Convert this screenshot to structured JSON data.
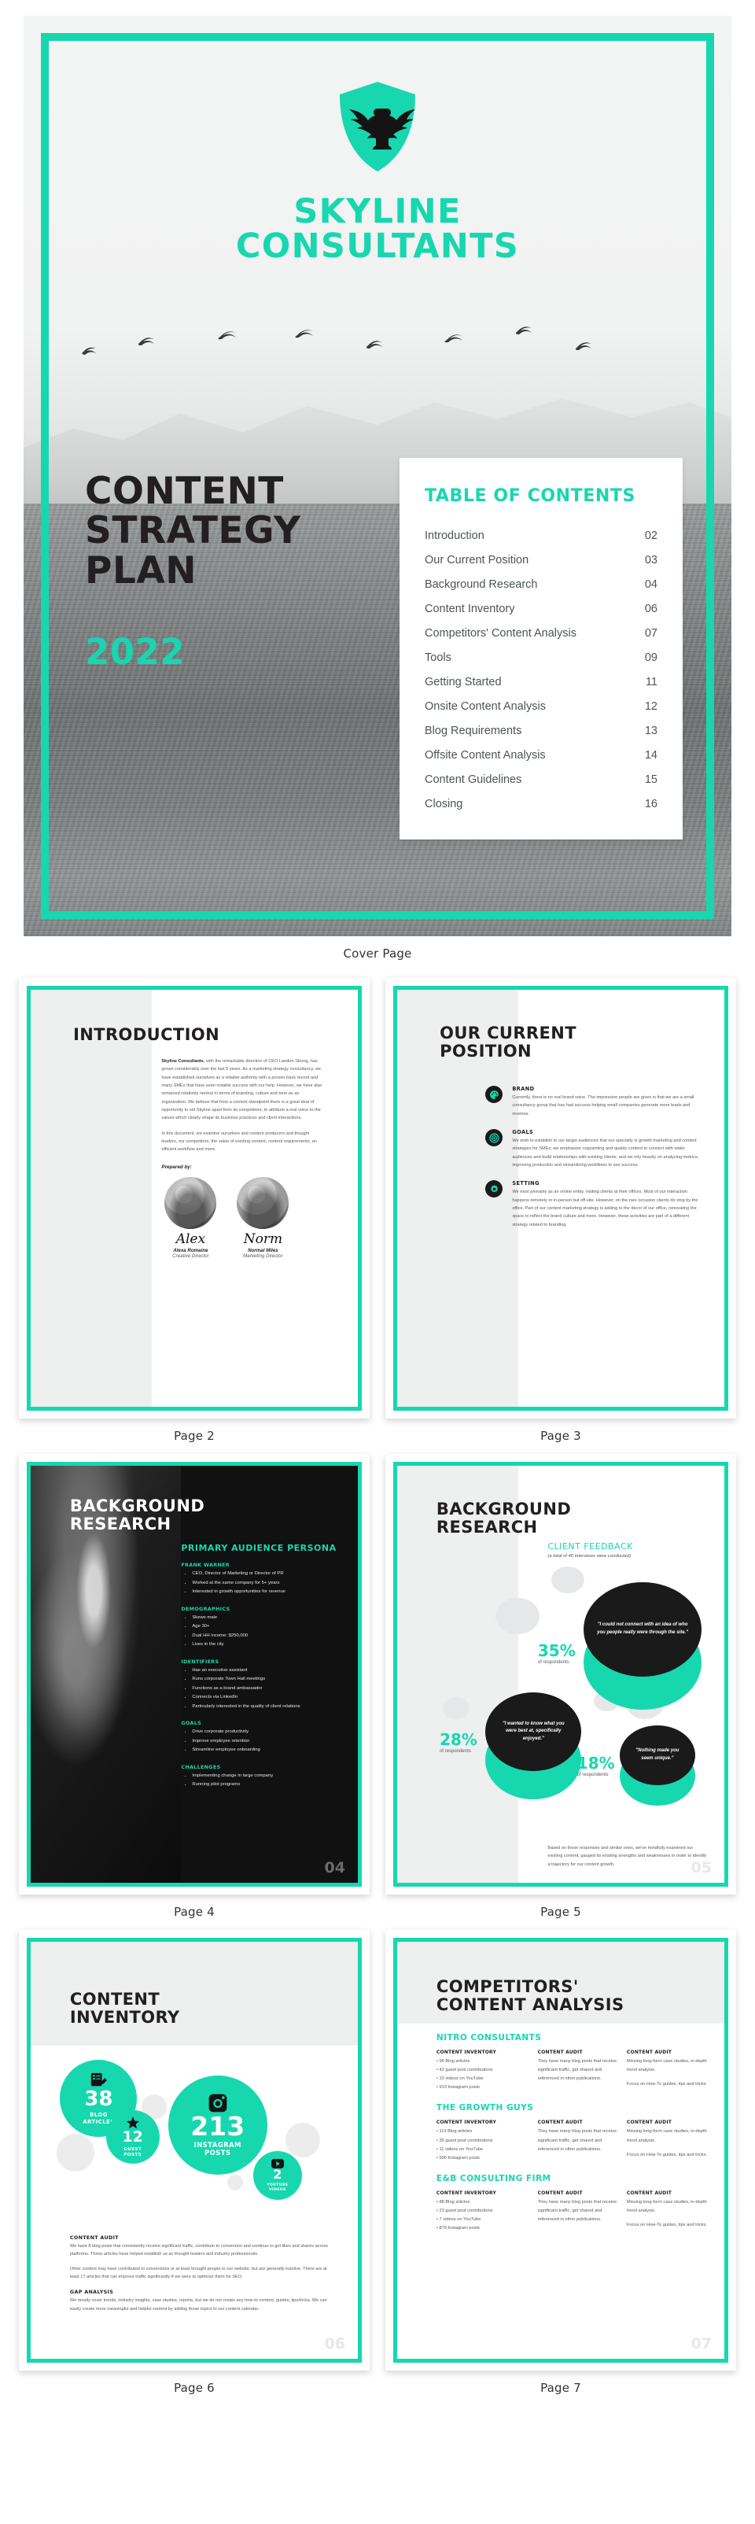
{
  "cover": {
    "brand_line1": "SKYLINE",
    "brand_line2": "CONSULTANTS",
    "logo_icon": "eagle-shield-logo",
    "heading_line1": "CONTENT",
    "heading_line2": "STRATEGY",
    "heading_line3": "PLAN",
    "year": "2022",
    "caption": "Cover Page",
    "accent": "#17d7af",
    "toc": {
      "title": "TABLE OF CONTENTS",
      "rows": [
        {
          "label": "Introduction",
          "page": "02"
        },
        {
          "label": "Our Current Position",
          "page": "03"
        },
        {
          "label": "Background Research",
          "page": "04"
        },
        {
          "label": "Content Inventory",
          "page": "06"
        },
        {
          "label": "Competitors' Content Analysis",
          "page": "07"
        },
        {
          "label": "Tools",
          "page": "09"
        },
        {
          "label": "Getting Started",
          "page": "11"
        },
        {
          "label": "Onsite Content Analysis",
          "page": "12"
        },
        {
          "label": "Blog Requirements",
          "page": "13"
        },
        {
          "label": "Offsite Content Analysis",
          "page": "14"
        },
        {
          "label": "Content Guidelines",
          "page": "15"
        },
        {
          "label": "Closing",
          "page": "16"
        }
      ]
    }
  },
  "page2": {
    "caption": "Page 2",
    "title": "INTRODUCTION",
    "para1_lead": "Skyline Consultants",
    "para1_rest": ", with the remarkable direction of CEO Landon Strong, has grown considerably over the last 5 years. As a marketing strategy consultancy, we have established ourselves as a reliable authority with a proven track record and many SMEs that have seen notable success with our help. However, we have also remained relatively neutral in terms of branding, culture and tone as an organization. We believe that from a content standpoint there is a great deal of opportunity to set Skyline apart from its competitors, to attribute a real voice to the values which clearly shape its business practices and client interactions.",
    "para2": "In this document, we examine ourselves and content producers and thought leaders, our competitors, the value of existing content, content requirements, an efficient workflow and more.",
    "prepared_by": "Prepared by:",
    "people": [
      {
        "signature": "Alex",
        "name": "Alexa Romaine",
        "role": "Creative Director"
      },
      {
        "signature": "Norm",
        "name": "Normal Miles",
        "role": "Marketing Director"
      }
    ]
  },
  "page3": {
    "caption": "Page 3",
    "title_line1": "OUR CURRENT",
    "title_line2": "POSITION",
    "items": [
      {
        "icon": "palette-icon",
        "heading": "BRAND",
        "text": "Currently, there is no real brand voice. The impression people are given is that we are a small consultancy group that has had success helping small companies generate more leads and revenue."
      },
      {
        "icon": "target-icon",
        "heading": "GOALS",
        "text": "We wish to establish to our target audiences  that our specialty is growth marketing and content strategies for SMEs; we emphasize copywriting and quality content to connect with wider audiences and build relationships with existing clients; and we rely heavily on analyzing metrics, improving production and streamlining workflows to see success."
      },
      {
        "icon": "gear-icon",
        "heading": "SETTING",
        "text": "We exist primarily as an online entity, visiting clients at their offices. Most of our interaction happens remotely or in-person but off-site. However, on the rare occasion clients do stop by the office. Part of our content marketing strategy is adding to the decor of our office, renovating the space to reflect the brand culture and more. However, these activities are part of a different strategy related to branding."
      }
    ]
  },
  "page4": {
    "caption": "Page 4",
    "page_number": "04",
    "title_line1": "BACKGROUND",
    "title_line2": "RESEARCH",
    "section_title": "PRIMARY AUDIENCE PERSONA",
    "groups": [
      {
        "heading": "FRANK WARNER",
        "bullets": [
          "CEO, Director of Marketing or Director of PR",
          "Worked at the same company for 5+ years",
          "Interested in growth opportunities for revenue"
        ]
      },
      {
        "heading": "DEMOGRAPHICS",
        "bullets": [
          "Skews male",
          "Age 30+",
          "Dual HH income: $250,000",
          "Lives in the city"
        ]
      },
      {
        "heading": "IDENTIFIERS",
        "bullets": [
          "Has an executive assistant",
          "Runs corporate Town Hall meetings",
          "Functions as a brand ambassador",
          "Connects via LinkedIn",
          "Particularly interested in the quality of client relations"
        ]
      },
      {
        "heading": "GOALS",
        "bullets": [
          "Drive corporate productivity",
          "Improve employee retention",
          "Streamline employee onboarding"
        ]
      },
      {
        "heading": "CHALLENGES",
        "bullets": [
          "Implementing change in large company",
          "Running pilot programs"
        ]
      }
    ]
  },
  "page5": {
    "caption": "Page 5",
    "page_number": "05",
    "title_line1": "BACKGROUND",
    "title_line2": "RESEARCH",
    "section_title": "CLIENT FEEDBACK",
    "section_sub": "(a total of 40 interviews were conducted)",
    "quotes": [
      {
        "percent": "35%",
        "label": "of respondents",
        "quote": "\"I could not connect with an idea of who you people really were through the site.\""
      },
      {
        "percent": "28%",
        "label": "of respondents",
        "quote": "\"I wanted to know what you were best at, specifically enjoyed.\""
      },
      {
        "percent": "18%",
        "label": "of respondents",
        "quote": "\"Nothing made you seem unique.\""
      }
    ],
    "footer": "Based on these responses and similar ones, we've mindfully examined our existing content, gauged its existing strengths and weaknesses in order to identify a trajectory for our content growth."
  },
  "page6": {
    "caption": "Page 6",
    "page_number": "06",
    "title_line1": "CONTENT",
    "title_line2": "INVENTORY",
    "stats": [
      {
        "icon": "notes-pencil-icon",
        "value": "38",
        "label_line1": "BLOG",
        "label_line2": "ARTICLES"
      },
      {
        "icon": "star-icon",
        "value": "12",
        "label_line1": "GUEST",
        "label_line2": "POSTS"
      },
      {
        "icon": "instagram-icon",
        "value": "213",
        "label_line1": "INSTAGRAM",
        "label_line2": "POSTS"
      },
      {
        "icon": "youtube-icon",
        "value": "2",
        "label_line1": "YOUTUBE",
        "label_line2": "VIDEOS"
      }
    ],
    "audit_heading": "CONTENT AUDIT",
    "audit_p1": "We have 8 blog posts that consistently receive significant traffic, contribute to conversion and continue to get likes and shares across platforms. These articles have helped establish us as thought leaders and industry professionals.",
    "audit_p2": "Other content may have contributed to conversions or at least brought people to our website, but are generally inactive. There are at least 17 articles that can improve traffic significantly if we were to optimize them for SEO.",
    "gap_heading": "GAP ANALYSIS",
    "gap_p": "We mostly cover trends, industry insights, case studies, reports, but we do not create any how-to content, guides, tips/tricks. We can easily create more meaningful and helpful content by adding those topics to our content calendar."
  },
  "page7": {
    "caption": "Page 7",
    "page_number": "07",
    "title_line1": "COMPETITORS'",
    "title_line2": "CONTENT ANALYSIS",
    "col_headers": [
      "CONTENT INVENTORY",
      "CONTENT AUDIT",
      "CONTENT AUDIT"
    ],
    "competitors": [
      {
        "name": "NITRO CONSULTANTS",
        "inventory": [
          "96 Blog articles",
          "42 guest post contributions",
          "10 videos on YouTube",
          "913 Instagram posts"
        ],
        "audit1": "They have many blog posts that receive significant traffic, get shared and referenced in other publications.",
        "audit2a": "Missing long-form case studies, in-depth trend analysis.",
        "audit2b": "Focus on How-To guides, tips and tricks."
      },
      {
        "name": "THE GROWTH GUYS",
        "inventory": [
          "113 Blog articles",
          "35 guest post contributions",
          "11 videos on YouTube",
          "996 Instagram posts"
        ],
        "audit1": "They have many blog posts that receive significant traffic, get shared and referenced in other publications.",
        "audit2a": "Missing long-form case studies, in-depth trend analysis.",
        "audit2b": "Focus on How-To guides, tips and tricks."
      },
      {
        "name": "E&B CONSULTING FIRM",
        "inventory": [
          "88 Blog articles",
          "23 guest post contributions",
          "7 videos on YouTube",
          "879 Instagram posts"
        ],
        "audit1": "They have many blog posts that receive significant traffic, get shared and referenced in other publications.",
        "audit2a": "Missing long-form case studies, in-depth trend analysis.",
        "audit2b": "Focus on How-To guides, tips and tricks."
      }
    ]
  }
}
